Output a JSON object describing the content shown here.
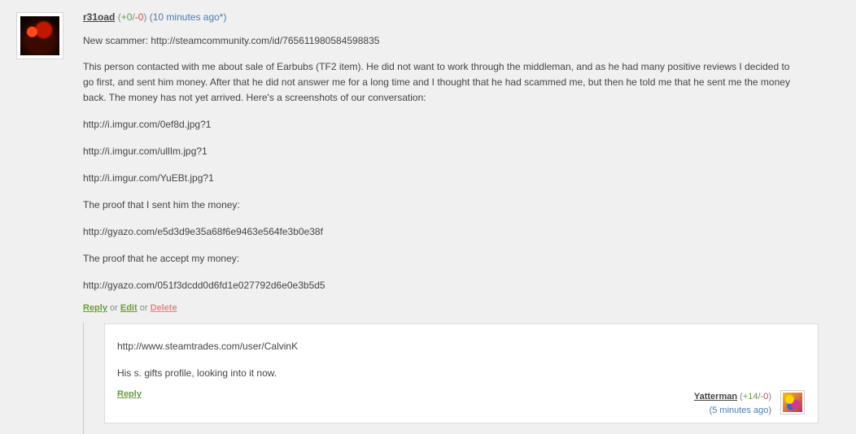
{
  "comment": {
    "username": "r31oad",
    "votes_open": "(",
    "plus": "+0",
    "slash": "/",
    "minus": "-0",
    "votes_close": ")",
    "time": "(10 minutes ago*)",
    "lines": [
      "New scammer: http://steamcommunity.com/id/765611980584598835",
      "This person contacted with me about sale of Earbubs (TF2 item). He did not want to work through the middleman, and as he had many positive reviews I decided to",
      "go first, and sent him money. After that he did not answer me for a long time and I thought that he had scammed me, but then he told me that he sent me the money",
      "back. The money has not yet arrived. Here's a screenshots of our conversation:",
      "http://i.imgur.com/0ef8d.jpg?1",
      "http://i.imgur.com/ullIm.jpg?1",
      "http://i.imgur.com/YuEBt.jpg?1",
      "The proof that I sent him the money:",
      "http://gyazo.com/e5d3d9e35a68f6e9463e564fe3b0e38f",
      "The proof that he accept my money:",
      "http://gyazo.com/051f3dcdd0d6fd1e027792d6e0e3b5d5"
    ],
    "actions": {
      "reply": "Reply",
      "or1": "or",
      "edit": "Edit",
      "or2": "or",
      "delete": "Delete"
    }
  },
  "reply": {
    "line1": "http://www.steamtrades.com/user/CalvinK",
    "line2": "His s. gifts profile, looking into it now.",
    "reply_label": "Reply",
    "username": "Yatterman",
    "votes_open": "(",
    "plus": "+14",
    "slash": "/",
    "minus": "-0",
    "votes_close": ")",
    "time": "(5 minutes ago)"
  }
}
